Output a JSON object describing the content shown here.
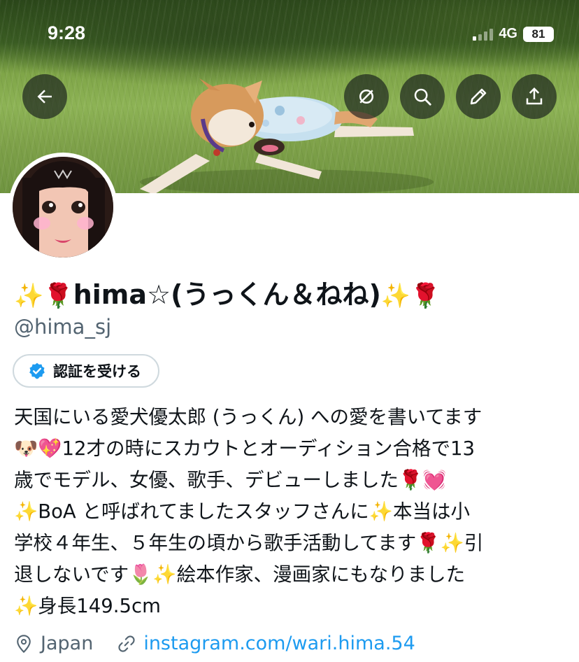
{
  "status_bar": {
    "time": "9:28",
    "network": "4G",
    "battery": "81"
  },
  "header": {
    "buttons": [
      "back-icon",
      "unfollow-circle-icon",
      "search-icon",
      "edit-icon",
      "share-icon"
    ]
  },
  "profile": {
    "display_name": "hima☆(うっくん＆ねね)",
    "name_emojis": {
      "sparkle": "✨",
      "rose": "🌹"
    },
    "handle": "@hima_sj",
    "verify_button_label": "認証を受ける",
    "bio_lines": [
      "天国にいる愛犬優太郎 (うっくん) への愛を書いてます",
      "🐶💖12才の時にスカウトとオーディション合格で13",
      "歳でモデル、女優、歌手、デビューしました🌹💓",
      "✨BoA と呼ばれてましたスタッフさんに✨本当は小",
      "学校４年生、５年生の頃から歌手活動してます🌹✨引",
      "退しないです🌷✨絵本作家、漫画家にもなりました",
      "✨身長149.5cm"
    ],
    "location": "Japan",
    "website": "instagram.com/wari.hima.54"
  },
  "colors": {
    "link": "#1d9bf0",
    "secondary_text": "#536471",
    "verify_badge": "#1d9bf0"
  }
}
